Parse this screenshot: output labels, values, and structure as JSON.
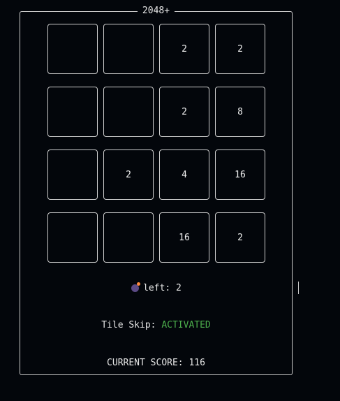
{
  "game": {
    "title": "2048+",
    "board": [
      [
        "",
        "",
        "2",
        "2"
      ],
      [
        "",
        "",
        "2",
        "8"
      ],
      [
        "",
        "2",
        "4",
        "16"
      ],
      [
        "",
        "",
        "16",
        "2"
      ]
    ]
  },
  "status": {
    "bombs_icon": "bomb-icon",
    "bombs_label": "left: 2",
    "tile_skip_label": "Tile Skip: ",
    "tile_skip_value": "ACTIVATED",
    "score_label": "CURRENT SCORE: 116"
  },
  "colors": {
    "background": "#03060b",
    "border": "#cfcfcf",
    "activated": "#4cae4c",
    "bomb_body": "#5b4a86",
    "bomb_fuse": "#ff8a3d"
  }
}
